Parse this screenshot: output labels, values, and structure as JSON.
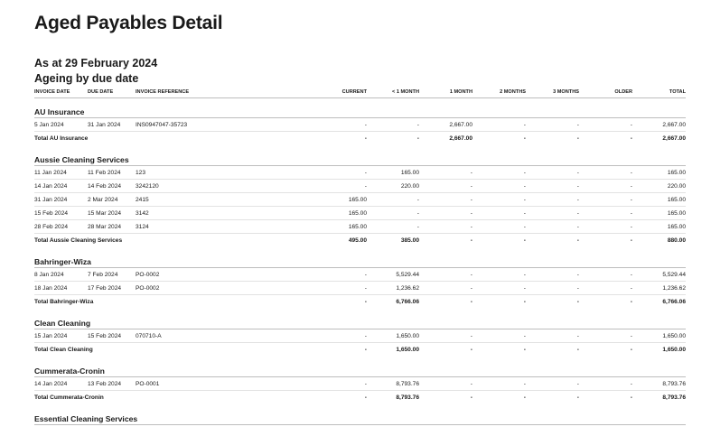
{
  "report": {
    "title": "Aged Payables Detail",
    "as_at": "As at 29 February 2024",
    "ageing": "Ageing by due date"
  },
  "columns": [
    "INVOICE DATE",
    "DUE DATE",
    "INVOICE REFERENCE",
    "CURRENT",
    "< 1 MONTH",
    "1 MONTH",
    "2 MONTHS",
    "3 MONTHS",
    "OLDER",
    "TOTAL"
  ],
  "groups": [
    {
      "name": "AU Insurance",
      "rows": [
        [
          "5 Jan 2024",
          "31 Jan 2024",
          "INS0947047-35723",
          "-",
          "-",
          "2,667.00",
          "-",
          "-",
          "-",
          "2,667.00"
        ]
      ],
      "total": [
        "Total AU Insurance",
        "-",
        "-",
        "2,667.00",
        "-",
        "-",
        "-",
        "2,667.00"
      ]
    },
    {
      "name": "Aussie Cleaning Services",
      "rows": [
        [
          "11 Jan 2024",
          "11 Feb 2024",
          "123",
          "-",
          "165.00",
          "-",
          "-",
          "-",
          "-",
          "165.00"
        ],
        [
          "14 Jan 2024",
          "14 Feb 2024",
          "3242120",
          "-",
          "220.00",
          "-",
          "-",
          "-",
          "-",
          "220.00"
        ],
        [
          "31 Jan 2024",
          "2 Mar 2024",
          "2415",
          "165.00",
          "-",
          "-",
          "-",
          "-",
          "-",
          "165.00"
        ],
        [
          "15 Feb 2024",
          "15 Mar 2024",
          "3142",
          "165.00",
          "-",
          "-",
          "-",
          "-",
          "-",
          "165.00"
        ],
        [
          "28 Feb 2024",
          "28 Mar 2024",
          "3124",
          "165.00",
          "-",
          "-",
          "-",
          "-",
          "-",
          "165.00"
        ]
      ],
      "total": [
        "Total Aussie Cleaning Services",
        "495.00",
        "385.00",
        "-",
        "-",
        "-",
        "-",
        "880.00"
      ]
    },
    {
      "name": "Bahringer-Wiza",
      "rows": [
        [
          "8 Jan 2024",
          "7 Feb 2024",
          "PO-0002",
          "-",
          "5,529.44",
          "-",
          "-",
          "-",
          "-",
          "5,529.44"
        ],
        [
          "18 Jan 2024",
          "17 Feb 2024",
          "PO-0002",
          "-",
          "1,236.62",
          "-",
          "-",
          "-",
          "-",
          "1,236.62"
        ]
      ],
      "total": [
        "Total Bahringer-Wiza",
        "-",
        "6,766.06",
        "-",
        "-",
        "-",
        "-",
        "6,766.06"
      ]
    },
    {
      "name": "Clean Cleaning",
      "rows": [
        [
          "15 Jan 2024",
          "15 Feb 2024",
          "070710-A",
          "-",
          "1,650.00",
          "-",
          "-",
          "-",
          "-",
          "1,650.00"
        ]
      ],
      "total": [
        "Total Clean Cleaning",
        "-",
        "1,650.00",
        "-",
        "-",
        "-",
        "-",
        "1,650.00"
      ]
    },
    {
      "name": "Cummerata-Cronin",
      "rows": [
        [
          "14 Jan 2024",
          "13 Feb 2024",
          "PO-0001",
          "-",
          "8,793.76",
          "-",
          "-",
          "-",
          "-",
          "8,793.76"
        ]
      ],
      "total": [
        "Total Cummerata-Cronin",
        "-",
        "8,793.76",
        "-",
        "-",
        "-",
        "-",
        "8,793.76"
      ]
    },
    {
      "name": "Essential Cleaning Services",
      "rows": [],
      "total": null
    }
  ]
}
